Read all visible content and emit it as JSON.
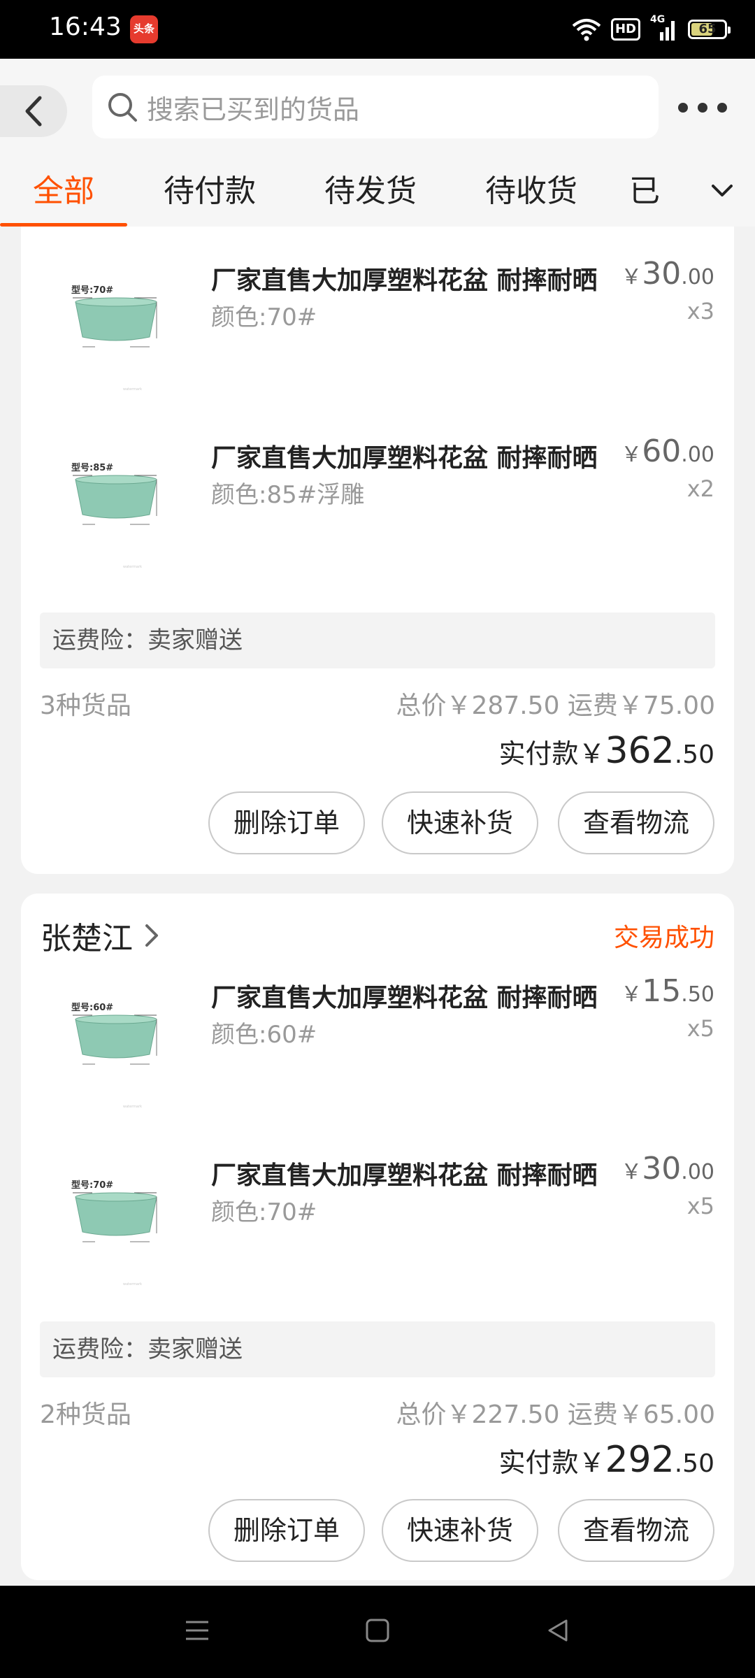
{
  "status_bar": {
    "time": "16:43",
    "app_badge": "头条",
    "network": "4G",
    "hd": "HD",
    "battery": "65"
  },
  "header": {
    "search_placeholder": "搜索已买到的货品"
  },
  "tabs": [
    {
      "label": "全部",
      "active": true
    },
    {
      "label": "待付款"
    },
    {
      "label": "待发货"
    },
    {
      "label": "待收货"
    },
    {
      "label": "已"
    }
  ],
  "accent_color": "#ff5000",
  "orders": [
    {
      "items": [
        {
          "title": "厂家直售大加厚塑料花盆 耐摔耐晒",
          "spec": "颜色:70#",
          "price_int": "30",
          "price_dec": ".00",
          "qty": "x3",
          "model": "型号:70#"
        },
        {
          "title": "厂家直售大加厚塑料花盆 耐摔耐晒",
          "spec": "颜色:85#浮雕",
          "price_int": "60",
          "price_dec": ".00",
          "qty": "x2",
          "model": "型号:85#"
        }
      ],
      "insurance": "运费险：卖家赠送",
      "count": "3种货品",
      "totals": "总价￥287.50   运费￥75.00",
      "paid_label": "实付款￥",
      "paid_int": "362",
      "paid_dec": ".50",
      "buttons": [
        "删除订单",
        "快速补货",
        "查看物流"
      ]
    },
    {
      "shop": "张楚江",
      "status": "交易成功",
      "items": [
        {
          "title": "厂家直售大加厚塑料花盆 耐摔耐晒",
          "spec": "颜色:60#",
          "price_int": "15",
          "price_dec": ".50",
          "qty": "x5",
          "model": "型号:60#"
        },
        {
          "title": "厂家直售大加厚塑料花盆 耐摔耐晒",
          "spec": "颜色:70#",
          "price_int": "30",
          "price_dec": ".00",
          "qty": "x5",
          "model": "型号:70#"
        }
      ],
      "insurance": "运费险：卖家赠送",
      "count": "2种货品",
      "totals": "总价￥227.50   运费￥65.00",
      "paid_label": "实付款￥",
      "paid_int": "292",
      "paid_dec": ".50",
      "buttons": [
        "删除订单",
        "快速补货",
        "查看物流"
      ]
    }
  ],
  "currency": "￥"
}
